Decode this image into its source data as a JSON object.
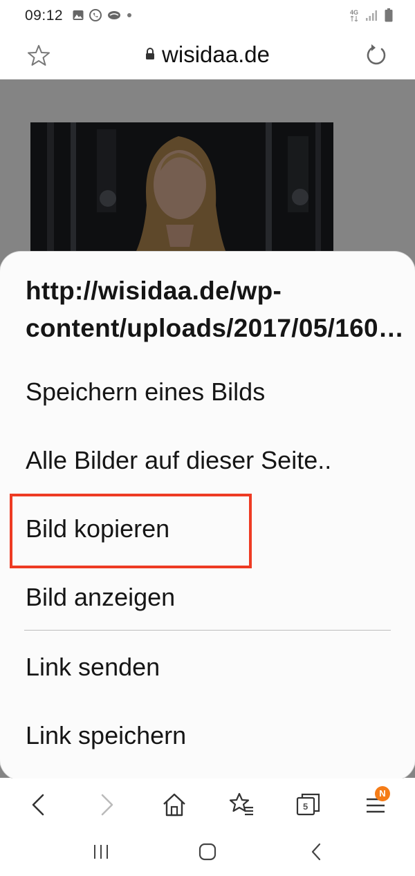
{
  "status_bar": {
    "time": "09:12",
    "left_icons": [
      "gallery-icon",
      "whatsapp-icon",
      "cloud-icon",
      "dot-icon"
    ],
    "network_label": "4G",
    "right_icons": [
      "network-4g-icon",
      "signal-icon",
      "battery-icon"
    ]
  },
  "url_bar": {
    "domain": "wisidaa.de",
    "icons": [
      "star-icon",
      "lock-icon",
      "reload-icon"
    ]
  },
  "context_menu": {
    "image_url": "http://wisidaa.de/wp-content/uploads/2017/05/160…",
    "items": [
      "Speichern eines Bilds",
      "Alle Bilder auf dieser Seite..",
      "Bild kopieren",
      "Bild anzeigen",
      "Link senden",
      "Link speichern"
    ],
    "highlighted_item": "Bild kopieren",
    "highlight_color": "#ee3b23"
  },
  "toolbar": {
    "tabs_count": "5",
    "menu_badge": "N",
    "badge_color": "#f57c17",
    "icons": [
      "back-icon",
      "forward-icon",
      "home-icon",
      "bookmarks-icon",
      "tabs-icon",
      "menu-icon"
    ]
  },
  "navbar": {
    "icons": [
      "recent-apps-icon",
      "home-nav-icon",
      "back-nav-icon"
    ]
  }
}
